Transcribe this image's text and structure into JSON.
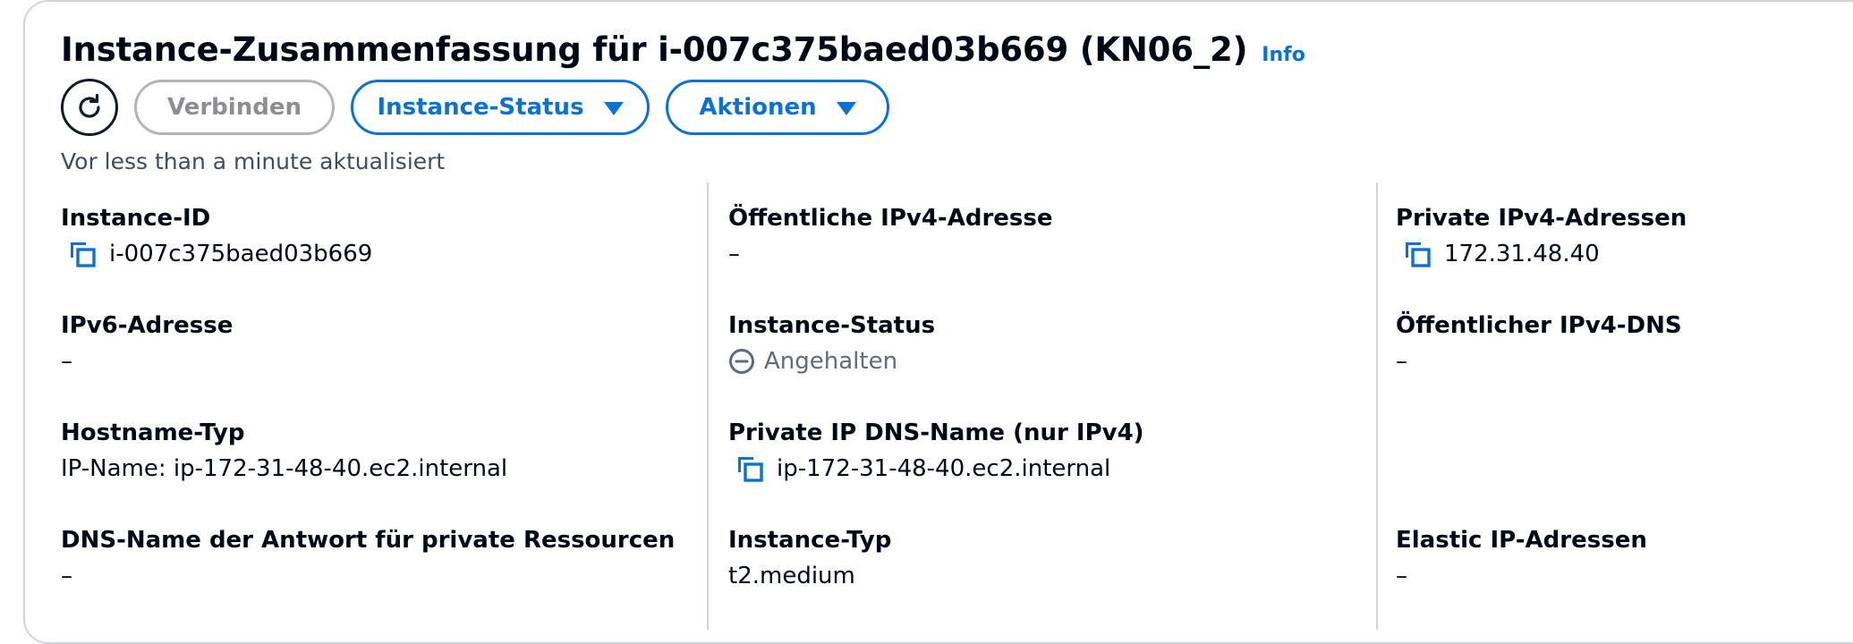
{
  "header": {
    "title": "Instance-Zusammenfassung für i-007c375baed03b669 (KN06_2)",
    "info_link": "Info"
  },
  "toolbar": {
    "refresh_icon": "refresh-icon",
    "connect_label": "Verbinden",
    "instance_status_label": "Instance-Status",
    "actions_label": "Aktionen"
  },
  "updated_text": "Vor less than a minute aktualisiert",
  "columns": {
    "left": [
      {
        "label": "Instance-ID",
        "value": "i-007c375baed03b669",
        "copyable": true
      },
      {
        "label": "IPv6-Adresse",
        "value": "–"
      },
      {
        "label": "Hostname-Typ",
        "value": "IP-Name: ip-172-31-48-40.ec2.internal"
      },
      {
        "label": "DNS-Name der Antwort für private Ressourcen",
        "value": "–"
      }
    ],
    "middle": [
      {
        "label": "Öffentliche IPv4-Adresse",
        "value": "–"
      },
      {
        "label": "Instance-Status",
        "value": "Angehalten",
        "status": "stopped"
      },
      {
        "label": "Private IP DNS-Name (nur IPv4)",
        "value": "ip-172-31-48-40.ec2.internal",
        "copyable": true
      },
      {
        "label": "Instance-Typ",
        "value": "t2.medium"
      }
    ],
    "right": [
      {
        "label": "Private IPv4-Adressen",
        "value": "172.31.48.40",
        "copyable": true
      },
      {
        "label": "Öffentlicher IPv4-DNS",
        "value": "–"
      },
      {
        "label": "Elastic IP-Adressen",
        "value": "–"
      }
    ]
  },
  "colors": {
    "accent": "#0972d3",
    "text": "#000716",
    "muted": "#5f6b7a",
    "disabled": "#8d8d94",
    "border": "#d1d5db"
  }
}
